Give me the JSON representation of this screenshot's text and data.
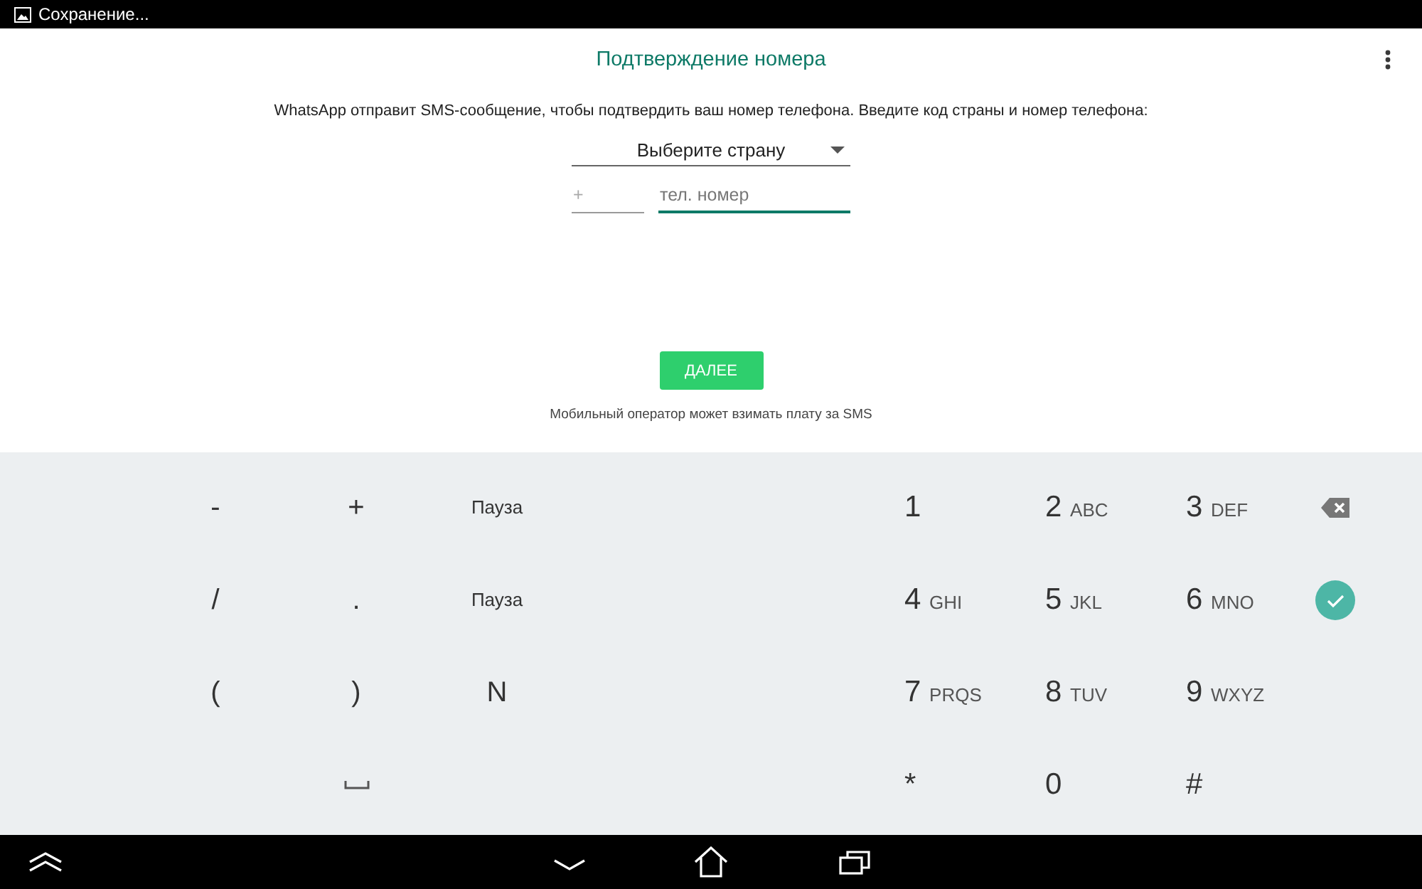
{
  "status_bar": {
    "notification": "Сохранение..."
  },
  "app_bar": {
    "title": "Подтверждение номера"
  },
  "intro": "WhatsApp отправит SMS-сообщение, чтобы подтвердить ваш номер телефона. Введите код страны и номер телефона:",
  "country_picker": {
    "value": "Выберите страну"
  },
  "country_code": {
    "placeholder": "+",
    "focused": false
  },
  "phone_number": {
    "placeholder": "тел. номер",
    "focused": true
  },
  "next_button": {
    "label": "ДАЛЕЕ"
  },
  "sms_note": "Мобильный оператор может взимать плату за SMS",
  "keyboard": {
    "left_rows": [
      [
        {
          "kind": "char",
          "label": "-"
        },
        {
          "kind": "char",
          "label": "+"
        },
        {
          "kind": "word",
          "label": "Пауза"
        }
      ],
      [
        {
          "kind": "char",
          "label": "/"
        },
        {
          "kind": "char",
          "label": "."
        },
        {
          "kind": "word",
          "label": "Пауза"
        }
      ],
      [
        {
          "kind": "char",
          "label": "("
        },
        {
          "kind": "char",
          "label": ")"
        },
        {
          "kind": "char",
          "label": "N"
        }
      ],
      [
        {
          "kind": "space"
        }
      ]
    ],
    "right_rows": [
      [
        {
          "kind": "digit",
          "digit": "1"
        },
        {
          "kind": "digit",
          "digit": "2",
          "letters": "ABC"
        },
        {
          "kind": "digit",
          "digit": "3",
          "letters": "DEF"
        },
        {
          "kind": "backspace"
        }
      ],
      [
        {
          "kind": "digit",
          "digit": "4",
          "letters": "GHI"
        },
        {
          "kind": "digit",
          "digit": "5",
          "letters": "JKL"
        },
        {
          "kind": "digit",
          "digit": "6",
          "letters": "MNO"
        },
        {
          "kind": "done"
        }
      ],
      [
        {
          "kind": "digit",
          "digit": "7",
          "letters": "PRQS"
        },
        {
          "kind": "digit",
          "digit": "8",
          "letters": "TUV"
        },
        {
          "kind": "digit",
          "digit": "9",
          "letters": "WXYZ"
        }
      ],
      [
        {
          "kind": "digit",
          "digit": "*"
        },
        {
          "kind": "digit",
          "digit": "0"
        },
        {
          "kind": "digit",
          "digit": "#"
        }
      ]
    ]
  }
}
